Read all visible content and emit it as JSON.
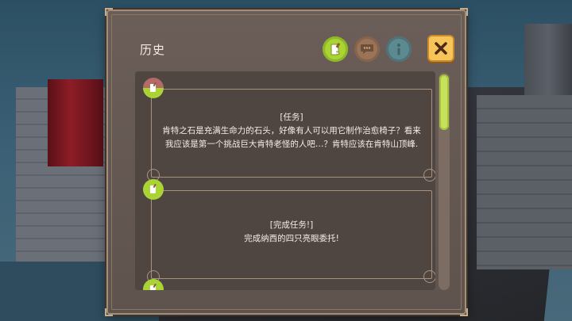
{
  "panel": {
    "title": "历史",
    "tabs": [
      {
        "name": "quest",
        "icon": "quest-scroll-icon",
        "active": true
      },
      {
        "name": "chat",
        "icon": "speech-bubble-icon",
        "active": false
      },
      {
        "name": "info",
        "icon": "info-icon",
        "active": false
      }
    ],
    "close_icon": "close-icon"
  },
  "entries": [
    {
      "icon": "quest-scroll-icon",
      "heading": "[任务]",
      "lines": [
        "肯特之石是充满生命力的石头，好像有人可以用它制作治愈椅子？看来",
        "我应该是第一个挑战巨大肯特老怪的人吧…？肯特应该在肯特山顶峰."
      ]
    },
    {
      "icon": "quest-scroll-icon",
      "heading": "[完成任务!]",
      "lines": [
        "完成纳西的四只亮眼委托!"
      ]
    },
    {
      "icon": "quest-scroll-icon",
      "heading": "",
      "lines": []
    }
  ],
  "colors": {
    "accent_green": "#a9d433",
    "panel_bg": "#6b5e58",
    "close_yellow": "#f7c45a"
  }
}
